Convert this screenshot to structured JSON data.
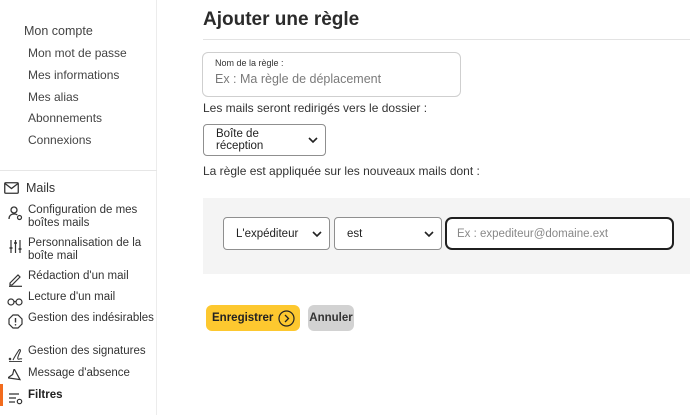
{
  "sidebar": {
    "account_title": "Mon compte",
    "account_items": [
      {
        "label": "Mon mot de passe"
      },
      {
        "label": "Mes informations"
      },
      {
        "label": "Mes alias"
      },
      {
        "label": "Abonnements"
      },
      {
        "label": "Connexions"
      }
    ],
    "mails_title": "Mails",
    "mail_items": [
      {
        "label": "Configuration de mes boîtes mails",
        "icon": "user-gear-icon"
      },
      {
        "label": "Personnalisation de la boîte mail",
        "icon": "sliders-icon"
      },
      {
        "label": "Rédaction d'un mail",
        "icon": "pen-icon"
      },
      {
        "label": "Lecture d'un mail",
        "icon": "glasses-icon"
      },
      {
        "label": "Gestion des indésirables",
        "icon": "alert-octagon-icon"
      },
      {
        "label": "Gestion des signatures",
        "icon": "signature-icon"
      },
      {
        "label": "Message d'absence",
        "icon": "plane-icon"
      },
      {
        "label": "Filtres",
        "icon": "filter-icon",
        "active": true
      }
    ]
  },
  "main": {
    "title": "Ajouter une règle",
    "rule_name": {
      "label": "Nom de la règle :",
      "placeholder": "Ex : Ma règle de déplacement",
      "value": ""
    },
    "redirect_text": "Les mails seront redirigés vers le dossier :",
    "folder_select": {
      "selected": "Boîte de réception"
    },
    "applies_text": "La règle est appliquée sur les nouveaux mails dont :",
    "condition": {
      "field_select": {
        "selected": "L'expéditeur"
      },
      "operator_select": {
        "selected": "est"
      },
      "value_input": {
        "placeholder": "Ex : expediteur@domaine.ext",
        "value": ""
      }
    },
    "buttons": {
      "save": "Enregistrer",
      "cancel": "Annuler"
    }
  },
  "colors": {
    "accent": "#fdc82f",
    "active_bar": "#f26b1d",
    "cancel_bg": "#d2d2d2",
    "panel_bg": "#f4f4f4"
  }
}
